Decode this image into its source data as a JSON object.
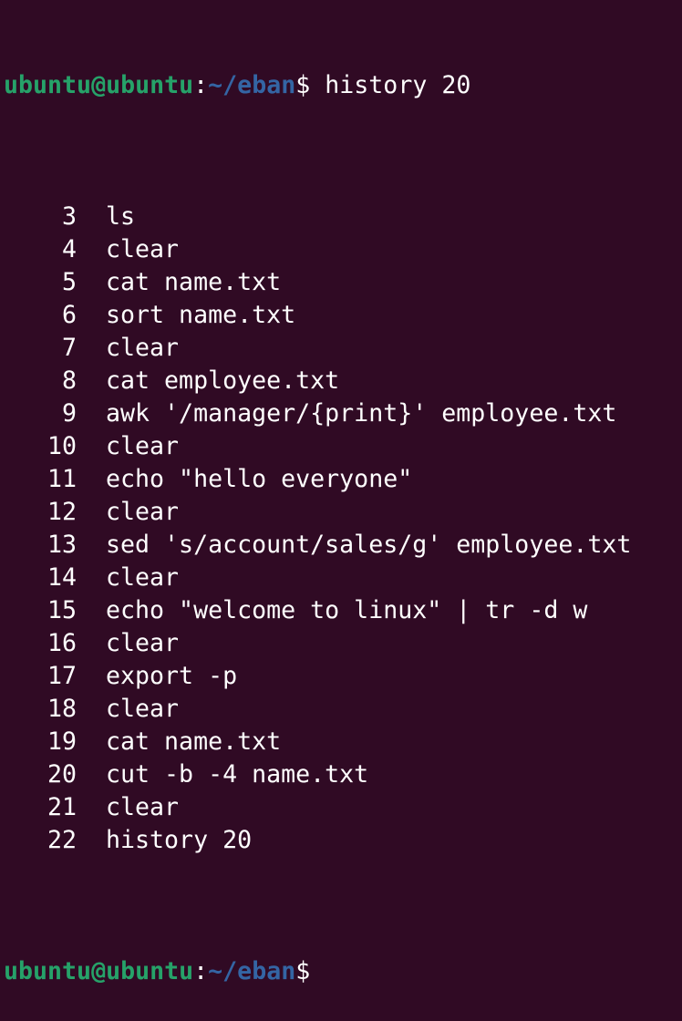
{
  "prompt": {
    "user_host": "ubuntu@ubuntu",
    "separator": ":",
    "path": "~/eban",
    "symbol": "$"
  },
  "command": " history 20",
  "history": [
    {
      "num": "3",
      "cmd": "ls"
    },
    {
      "num": "4",
      "cmd": "clear"
    },
    {
      "num": "5",
      "cmd": "cat name.txt"
    },
    {
      "num": "6",
      "cmd": "sort name.txt"
    },
    {
      "num": "7",
      "cmd": "clear"
    },
    {
      "num": "8",
      "cmd": "cat employee.txt"
    },
    {
      "num": "9",
      "cmd": "awk '/manager/{print}' employee.txt"
    },
    {
      "num": "10",
      "cmd": "clear"
    },
    {
      "num": "11",
      "cmd": "echo \"hello everyone\""
    },
    {
      "num": "12",
      "cmd": "clear"
    },
    {
      "num": "13",
      "cmd": "sed 's/account/sales/g' employee.txt"
    },
    {
      "num": "14",
      "cmd": "clear"
    },
    {
      "num": "15",
      "cmd": "echo \"welcome to linux\" | tr -d w"
    },
    {
      "num": "16",
      "cmd": "clear"
    },
    {
      "num": "17",
      "cmd": "export -p"
    },
    {
      "num": "18",
      "cmd": "clear"
    },
    {
      "num": "19",
      "cmd": "cat name.txt"
    },
    {
      "num": "20",
      "cmd": "cut -b -4 name.txt"
    },
    {
      "num": "21",
      "cmd": "clear"
    },
    {
      "num": "22",
      "cmd": "history 20"
    }
  ],
  "colors": {
    "background": "#300a24",
    "user_host": "#26a269",
    "path": "#3465a4",
    "text": "#ffffff"
  }
}
